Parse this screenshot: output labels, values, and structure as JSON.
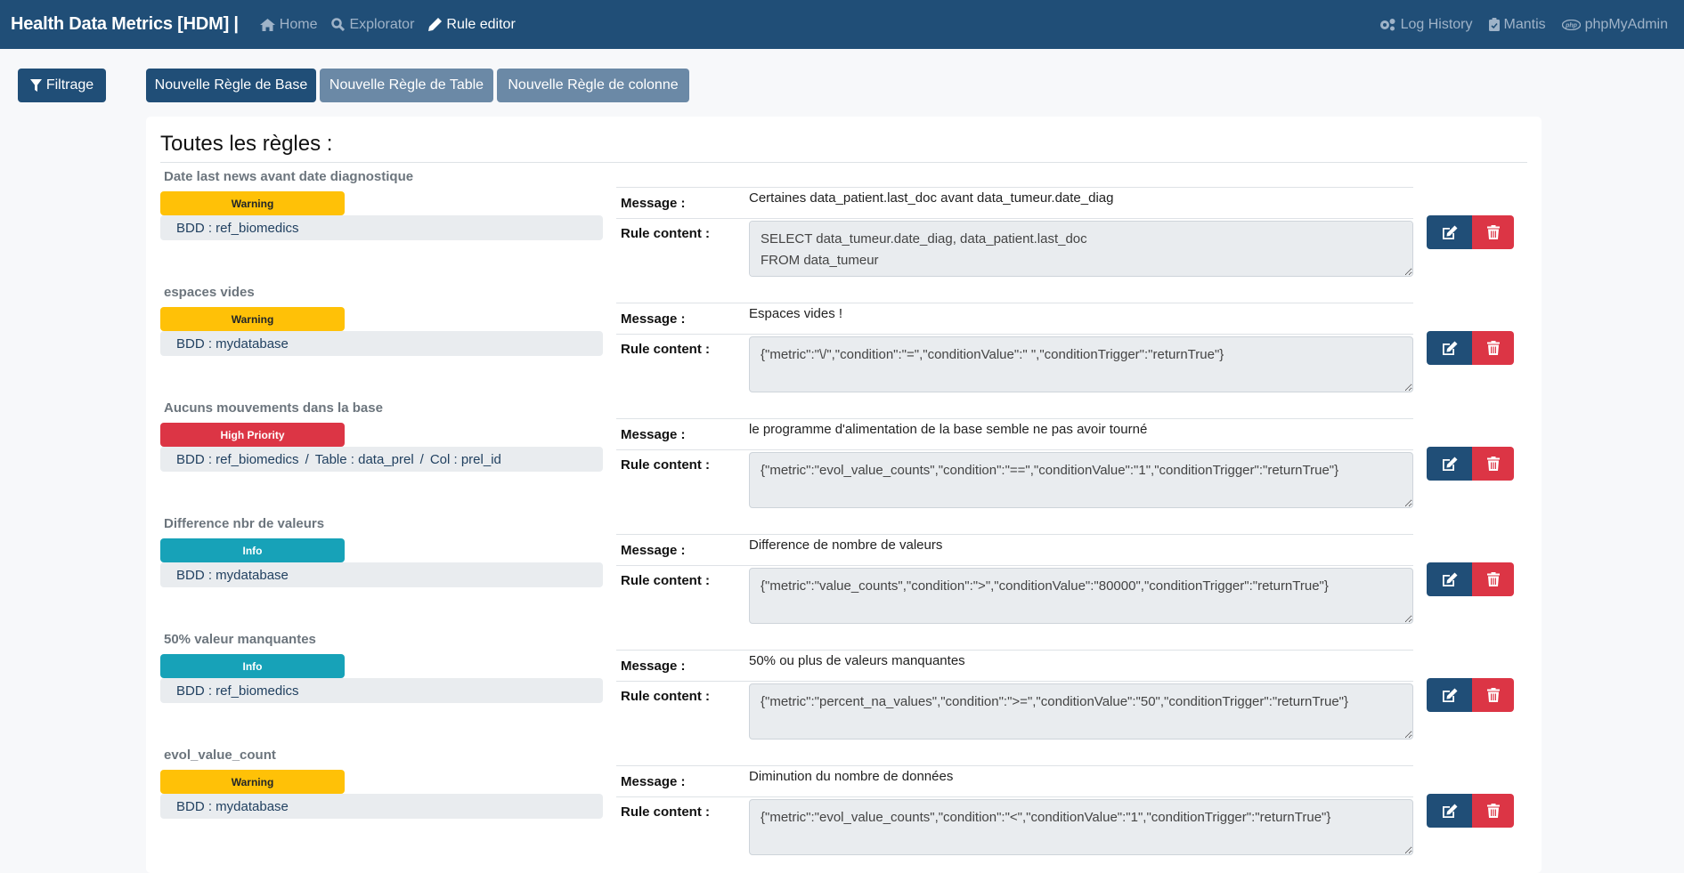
{
  "navbar": {
    "brand": "Health Data Metrics [HDM] |",
    "left_links": [
      {
        "label": "Home",
        "icon": "home-icon"
      },
      {
        "label": "Explorator",
        "icon": "search-icon"
      },
      {
        "label": "Rule editor",
        "icon": "pencil-icon",
        "active": true
      }
    ],
    "right_links": [
      {
        "label": "Log History",
        "icon": "gears-icon"
      },
      {
        "label": "Mantis",
        "icon": "clipboard-check-icon"
      },
      {
        "label": "phpMyAdmin",
        "icon": "php-icon"
      }
    ]
  },
  "toolbar": {
    "filter_label": "Filtrage",
    "new_base_label": "Nouvelle Règle de Base",
    "new_table_label": "Nouvelle Règle de Table",
    "new_column_label": "Nouvelle Règle de colonne"
  },
  "card": {
    "title": "Toutes les règles :",
    "message_label": "Message :",
    "rule_content_label": "Rule content :"
  },
  "rules": [
    {
      "name": "Date last news avant date diagnostique",
      "severity": "Warning",
      "scope": [
        "BDD : ref_biomedics"
      ],
      "message": "Certaines data_patient.last_doc avant data_tumeur.date_diag",
      "content": "SELECT data_tumeur.date_diag, data_patient.last_doc\nFROM data_tumeur"
    },
    {
      "name": "espaces vides",
      "severity": "Warning",
      "scope": [
        "BDD : mydatabase"
      ],
      "message": "Espaces vides !",
      "content": "{\"metric\":\"\\/\",\"condition\":\"=\",\"conditionValue\":\" \",\"conditionTrigger\":\"returnTrue\"}"
    },
    {
      "name": "Aucuns mouvements dans la base",
      "severity": "High Priority",
      "scope": [
        "BDD : ref_biomedics",
        "Table : data_prel",
        "Col : prel_id"
      ],
      "message": "le programme d'alimentation de la base semble ne pas avoir tourné",
      "content": "{\"metric\":\"evol_value_counts\",\"condition\":\"==\",\"conditionValue\":\"1\",\"conditionTrigger\":\"returnTrue\"}"
    },
    {
      "name": "Difference nbr de valeurs",
      "severity": "Info",
      "scope": [
        "BDD : mydatabase"
      ],
      "message": "Difference de nombre de valeurs",
      "content": "{\"metric\":\"value_counts\",\"condition\":\">\",\"conditionValue\":\"80000\",\"conditionTrigger\":\"returnTrue\"}"
    },
    {
      "name": "50% valeur manquantes",
      "severity": "Info",
      "scope": [
        "BDD : ref_biomedics"
      ],
      "message": "50% ou plus de valeurs manquantes",
      "content": "{\"metric\":\"percent_na_values\",\"condition\":\">=\",\"conditionValue\":\"50\",\"conditionTrigger\":\"returnTrue\"}"
    },
    {
      "name": "evol_value_count",
      "severity": "Warning",
      "scope": [
        "BDD : mydatabase"
      ],
      "message": "Diminution du nombre de données",
      "content": "{\"metric\":\"evol_value_counts\",\"condition\":\"<\",\"conditionValue\":\"1\",\"conditionTrigger\":\"returnTrue\"}"
    }
  ],
  "colors": {
    "primary": "#204e77",
    "muted": "#6b89a6",
    "warning": "#ffc107",
    "danger": "#dc3545",
    "info": "#17a2b8"
  }
}
